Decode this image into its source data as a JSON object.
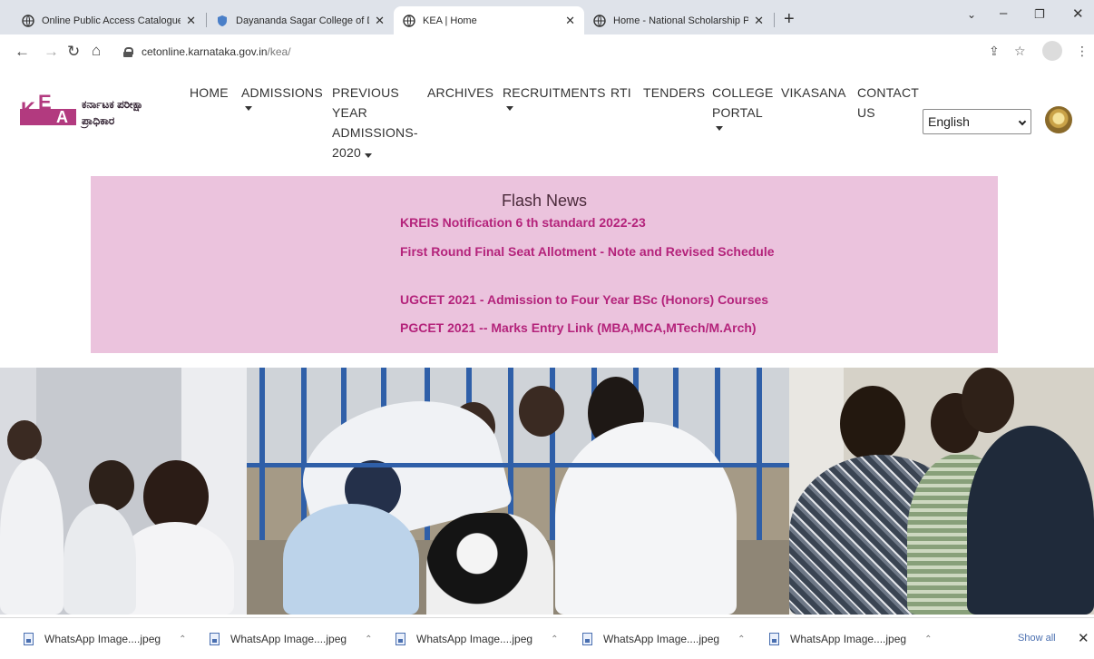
{
  "browser": {
    "tabs": [
      {
        "title": "Online Public Access Catalogue",
        "active": false
      },
      {
        "title": "Dayananda Sagar College of De",
        "active": false
      },
      {
        "title": "KEA | Home",
        "active": true
      },
      {
        "title": "Home - National Scholarship Po",
        "active": false
      }
    ],
    "url_domain": "cetonline.karnataka.gov.in",
    "url_path": "/kea/"
  },
  "site": {
    "logo_text_line1": "ಕರ್ನಾಟಕ ಪರೀಕ್ಷಾ",
    "logo_text_line2": "ಪ್ರಾಧಿಕಾರ",
    "nav": {
      "home": "HOME",
      "admissions": "ADMISSIONS",
      "previous_l1": "PREVIOUS",
      "previous_l2": "YEAR",
      "previous_l3": "ADMISSIONS-",
      "previous_l4": "2020",
      "archives": "ARCHIVES",
      "recruitments": "RECRUITMENTS",
      "rti": "RTI",
      "tenders": "TENDERS",
      "college_l1": "COLLEGE",
      "college_l2": "PORTAL",
      "vikasana": "VIKASANA",
      "contact_l1": "CONTACT",
      "contact_l2": "US"
    },
    "language_selected": "English"
  },
  "flash_news": {
    "title": "Flash News",
    "items": [
      "KREIS Notification 6 th standard 2022-23",
      "First Round Final Seat Allotment - Note and Revised Schedule",
      "UGCET 2021 - Admission to Four Year BSc (Honors) Courses",
      "PGCET 2021 -- Marks Entry Link (MBA,MCA,MTech/M.Arch)"
    ]
  },
  "downloads": {
    "items": [
      "WhatsApp Image....jpeg",
      "WhatsApp Image....jpeg",
      "WhatsApp Image....jpeg",
      "WhatsApp Image....jpeg",
      "WhatsApp Image....jpeg"
    ],
    "show_all": "Show all"
  },
  "colors": {
    "brand": "#b23a7f",
    "flash_bg": "#ebc3dd",
    "flash_link": "#b4237b"
  }
}
